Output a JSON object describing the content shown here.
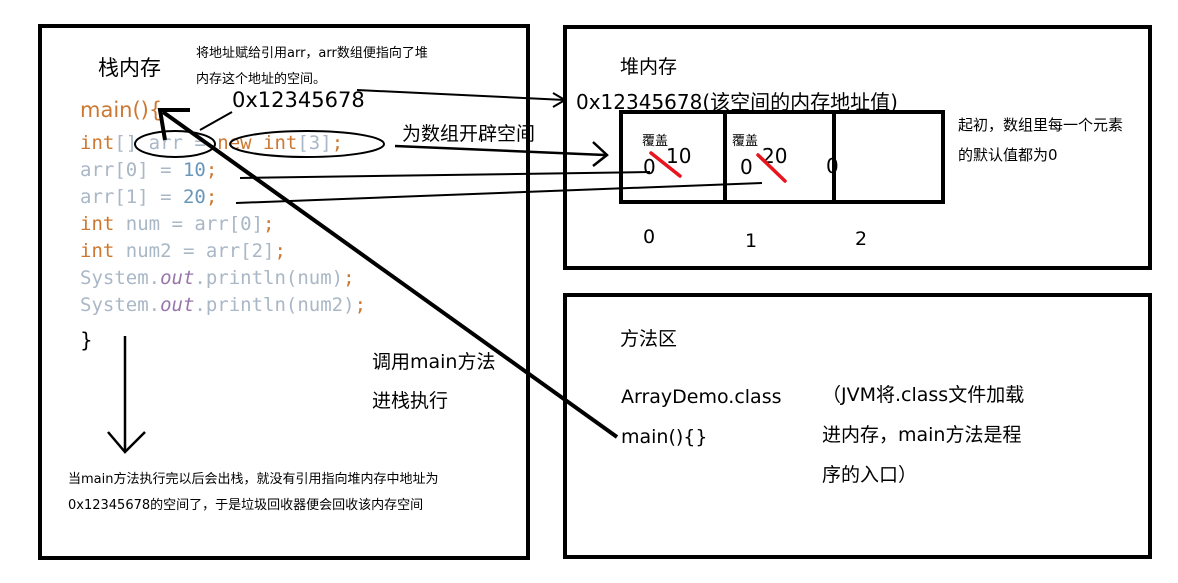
{
  "stack": {
    "title": "栈内存",
    "note": [
      "将地址赋给引用arr，arr数组便指向了堆",
      "内存这个地址的空间。"
    ],
    "address": "0x12345678",
    "code": {
      "main_open": "main(){",
      "l1_kw": "int",
      "l1_rest": "[] arr = ",
      "l1_new": "new int",
      "l1_idx": "[3]",
      "l1_end": ";",
      "l2_a": "arr[0] = ",
      "l2_v": "10",
      "l2_end": ";",
      "l3_a": "arr[1] = ",
      "l3_v": "20",
      "l3_end": ";",
      "l4_kw": "int",
      "l4_rest": " num = arr[0]",
      "l4_end": ";",
      "l5_kw": "int",
      "l5_rest": " num2 = arr[2]",
      "l5_end": ";",
      "l6_a": "System.",
      "l6_out": "out",
      "l6_b": ".println(num)",
      "l6_end": ";",
      "l7_a": "System.",
      "l7_out": "out",
      "l7_b": ".println(num2)",
      "l7_end": ";",
      "close": "}"
    },
    "call_note": [
      "调用main方法",
      "进栈执行"
    ],
    "exit_note": [
      "当main方法执行完以后会出栈，就没有引用指向堆内存中地址为",
      "0x12345678的空间了，于是垃圾回收器便会回收该内存空间"
    ]
  },
  "heap": {
    "title": "堆内存",
    "address": "0x12345678(该空间的内存地址值)",
    "alloc_note": "为数组开辟空间",
    "default_note": [
      "起初，数组里每一个元素",
      "的默认值都为0"
    ],
    "cells": [
      {
        "index": "0",
        "old": "0",
        "new": "10",
        "label": "覆盖"
      },
      {
        "index": "1",
        "old": "0",
        "new": "20",
        "label": "覆盖"
      },
      {
        "index": "2",
        "value": "0"
      }
    ],
    "strike_color": "#e8141e"
  },
  "method_area": {
    "title": "方法区",
    "class_name": "ArrayDemo.class",
    "method": "main(){}",
    "note": [
      "（JVM将.class文件加载",
      "进内存，main方法是程",
      "序的入口）"
    ]
  }
}
